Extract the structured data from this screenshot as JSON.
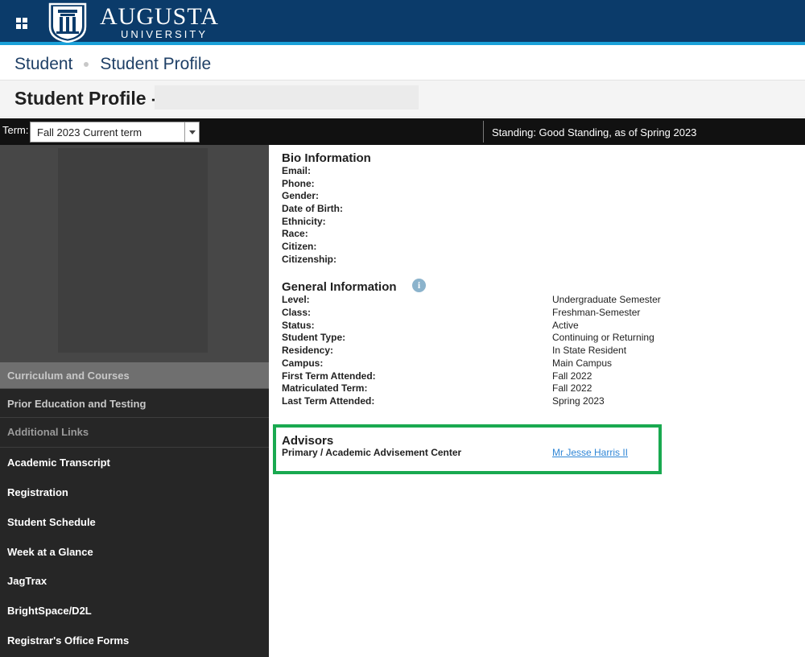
{
  "header": {
    "brand_main": "AUGUSTA",
    "brand_sub": "UNIVERSITY",
    "menu_icon": "grid-menu-icon",
    "logo_icon": "university-shield-logo"
  },
  "breadcrumb": [
    "Student",
    "Student Profile"
  ],
  "page": {
    "title": "Student Profile -"
  },
  "termbar": {
    "label": "Term:",
    "selected": "Fall 2023 Current term",
    "standing": "Standing: Good Standing, as of Spring 2023"
  },
  "sidebar": {
    "section_items": [
      "Curriculum and Courses",
      "Prior Education and Testing",
      "Additional Links"
    ],
    "links": [
      "Academic Transcript",
      "Registration",
      "Student Schedule",
      "Week at a Glance",
      "JagTrax",
      "BrightSpace/D2L",
      "Registrar's Office Forms"
    ]
  },
  "bio": {
    "title": "Bio Information",
    "fields": [
      "Email:",
      "Phone:",
      "Gender:",
      "Date of Birth:",
      "Ethnicity:",
      "Race:",
      "Citizen:",
      "Citizenship:"
    ]
  },
  "general": {
    "title": "General Information",
    "info_icon": "info-icon",
    "rows": [
      {
        "label": "Level:",
        "value": "Undergraduate Semester"
      },
      {
        "label": "Class:",
        "value": "Freshman-Semester"
      },
      {
        "label": "Status:",
        "value": "Active"
      },
      {
        "label": "Student Type:",
        "value": "Continuing or Returning"
      },
      {
        "label": "Residency:",
        "value": "In State Resident"
      },
      {
        "label": "Campus:",
        "value": "Main Campus"
      },
      {
        "label": "First Term Attended:",
        "value": "Fall 2022"
      },
      {
        "label": "Matriculated Term:",
        "value": "Fall 2022"
      },
      {
        "label": "Last Term Attended:",
        "value": "Spring 2023"
      }
    ]
  },
  "advisors": {
    "title": "Advisors",
    "role": "Primary / Academic Advisement Center",
    "name": "Mr Jesse Harris II"
  },
  "colors": {
    "header_bg": "#0b3b6a",
    "header_accent": "#1aa0d8",
    "highlight_box": "#19a950",
    "link": "#2f86d6"
  }
}
